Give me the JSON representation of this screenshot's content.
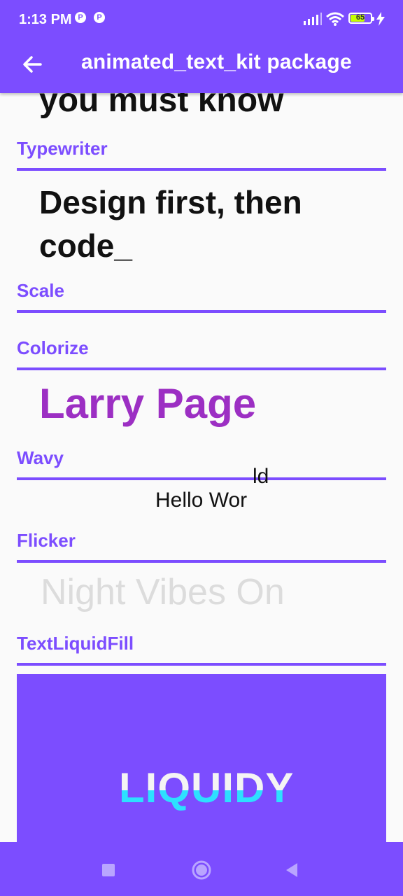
{
  "status_bar": {
    "time": "1:13 PM",
    "notif_icons": [
      "P",
      "P"
    ],
    "battery_level": "65",
    "icons": [
      "signal-icon",
      "wifi-icon",
      "battery-icon",
      "charging-bolt-icon"
    ]
  },
  "app_bar": {
    "title": "animated_text_kit package",
    "back_icon": "arrow-left-icon"
  },
  "content": {
    "scrolled_text": "you must know",
    "sections": {
      "typewriter": {
        "label": "Typewriter",
        "text": "Design first, then code_"
      },
      "scale": {
        "label": "Scale"
      },
      "colorize": {
        "label": "Colorize",
        "text": "Larry Page",
        "color": "#9c2fc3"
      },
      "wavy": {
        "label": "Wavy",
        "text_main": "Hello Wor",
        "text_offset": "ld"
      },
      "flicker": {
        "label": "Flicker",
        "text": "Night Vibes On"
      },
      "liquid": {
        "label": "TextLiquidFill",
        "text": "LIQUIDY",
        "box_color": "#7c4dff",
        "fill_color": "#2de0ff"
      }
    }
  },
  "nav_bar": {
    "icons": [
      "recents-square-icon",
      "home-circle-icon",
      "back-triangle-icon"
    ]
  },
  "colors": {
    "accent": "#7c4dff",
    "background": "#fafafa"
  }
}
